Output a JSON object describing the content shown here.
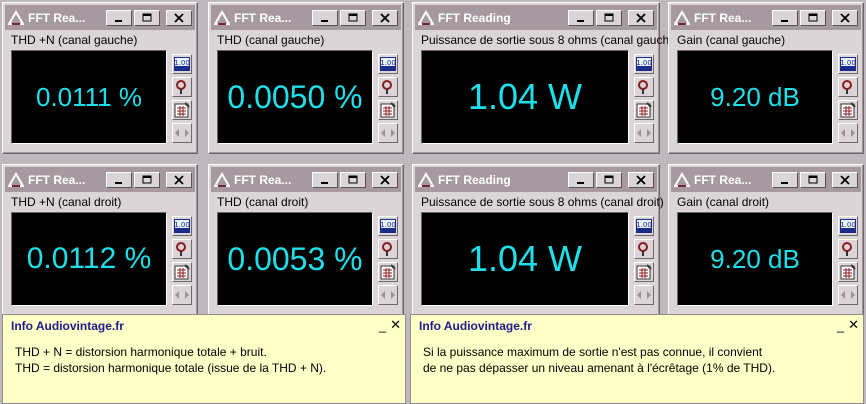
{
  "icons": {
    "app": "fft-triangle-icon",
    "minimize": "minimize-icon",
    "maximize": "maximize-icon",
    "close": "close-icon",
    "value_display": "value-display-icon",
    "probe": "probe-icon",
    "calculator": "calculator-icon",
    "arrows": "arrows-icon"
  },
  "colors": {
    "value_text": "#1ee0ea",
    "title_bar": "#a69aa0",
    "info_title": "#1c1c8c",
    "info_background": "#ffffc8"
  },
  "windows": [
    {
      "title": "FFT Rea...",
      "label": "THD +N (canal gauche)",
      "value": "0.0111 %"
    },
    {
      "title": "FFT Rea...",
      "label": "THD (canal gauche)",
      "value": "0.0050 %"
    },
    {
      "title": "FFT Reading",
      "label": "Puissance de sortie sous 8 ohms  (canal gauche)",
      "value": "1.04 W"
    },
    {
      "title": "FFT Rea...",
      "label": "Gain (canal gauche)",
      "value": "9.20 dB"
    },
    {
      "title": "FFT Rea...",
      "label": "THD +N (canal droit)",
      "value": "0.0112 %"
    },
    {
      "title": "FFT Rea...",
      "label": "THD (canal droit)",
      "value": "0.0053 %"
    },
    {
      "title": "FFT Reading",
      "label": "Puissance de sortie sous 8 ohms (canal droit)",
      "value": "1.04 W"
    },
    {
      "title": "FFT Rea...",
      "label": "Gain (canal droit)",
      "value": "9.20 dB"
    }
  ],
  "side_buttons": {
    "value_label": "1.00"
  },
  "info_panels": [
    {
      "title": "Info Audiovintage.fr",
      "minimize_label": "_",
      "close_label": "✕",
      "lines": [
        "THD + N = distorsion harmonique totale + bruit.",
        "THD = distorsion harmonique totale (issue de la THD + N)."
      ]
    },
    {
      "title": "Info Audiovintage.fr",
      "minimize_label": "_",
      "close_label": "✕",
      "lines": [
        "Si la  puissance maximum de sortie n'est pas connue, il convient",
        "de ne pas dépasser un niveau  amenant à l'écrêtage (1% de THD)."
      ]
    }
  ]
}
